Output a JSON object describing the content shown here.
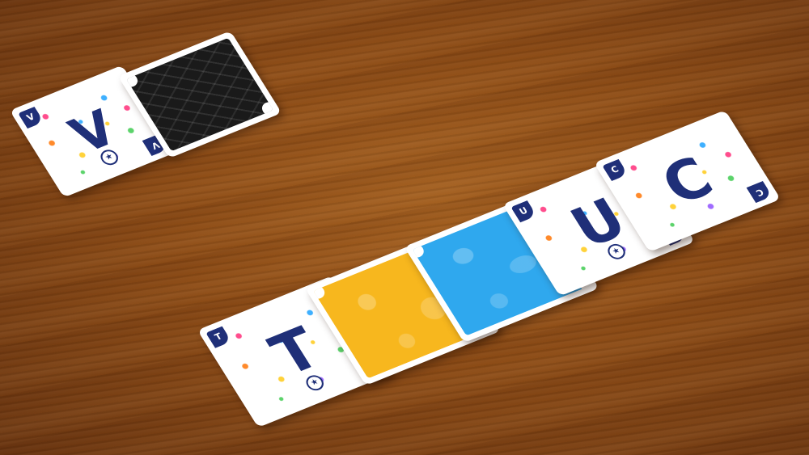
{
  "scene": {
    "surface": "wooden table",
    "colors": {
      "wood": "#8c4b15",
      "card_white": "#ffffff",
      "letter_navy": "#1f2f78",
      "yellow_back": "#f7b71e",
      "blue_back": "#2fa8ee",
      "black_back": "#1a1a1a"
    }
  },
  "cards": [
    {
      "name": "card-v",
      "letter": "V",
      "corner": "V",
      "kind": "letter"
    },
    {
      "name": "card-black-back",
      "kind": "back",
      "back_color": "black"
    },
    {
      "name": "card-t",
      "letter": "T",
      "corner": "T",
      "kind": "letter"
    },
    {
      "name": "card-yellow-back",
      "kind": "back",
      "back_color": "yellow"
    },
    {
      "name": "card-blue-back",
      "kind": "back",
      "back_color": "blue"
    },
    {
      "name": "card-u",
      "letter": "U",
      "corner": "U",
      "kind": "letter"
    },
    {
      "name": "card-c",
      "letter": "C",
      "corner": "C",
      "kind": "letter"
    }
  ]
}
